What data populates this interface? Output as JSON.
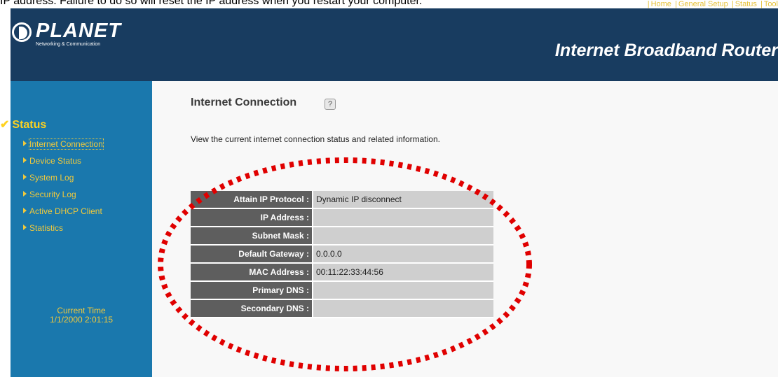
{
  "caption": "IP address. Failure to do so will reset the IP address when you restart your computer.",
  "header": {
    "logo_text": "PLANET",
    "logo_tagline": "Networking & Communication",
    "product_title": "Internet Broadband Router",
    "nav": [
      "Home",
      "General Setup",
      "Status",
      "Tool"
    ]
  },
  "sidebar": {
    "section_label": "Status",
    "items": [
      {
        "label": "Internet Connection"
      },
      {
        "label": "Device Status"
      },
      {
        "label": "System Log"
      },
      {
        "label": "Security Log"
      },
      {
        "label": "Active DHCP Client"
      },
      {
        "label": "Statistics"
      }
    ],
    "time_label": "Current Time",
    "time_value": "1/1/2000 2:01:15"
  },
  "main": {
    "title": "Internet Connection",
    "description": "View the current internet connection status and related information.",
    "rows": [
      {
        "key": "Attain IP Protocol :",
        "value": "Dynamic IP disconnect"
      },
      {
        "key": "IP Address :",
        "value": ""
      },
      {
        "key": "Subnet Mask :",
        "value": ""
      },
      {
        "key": "Default Gateway :",
        "value": "0.0.0.0"
      },
      {
        "key": "MAC Address :",
        "value": "00:11:22:33:44:56"
      },
      {
        "key": "Primary DNS :",
        "value": ""
      },
      {
        "key": "Secondary DNS :",
        "value": ""
      }
    ]
  },
  "colors": {
    "header_bg": "#183c60",
    "sidebar_bg": "#1a78ad",
    "link_color": "#f0c93c",
    "highlight_ellipse": "#e00000"
  },
  "icons": {
    "logo": "planet-logo-icon",
    "help": "help-icon",
    "check": "check-icon",
    "arrow": "triangle-arrow-icon"
  }
}
